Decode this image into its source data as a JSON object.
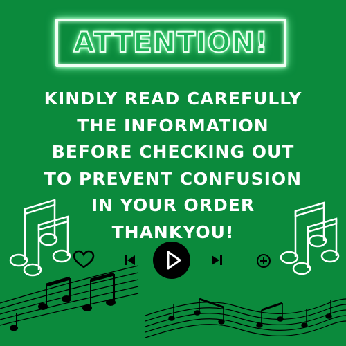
{
  "banner": {
    "title": "ATTENTION!"
  },
  "message": {
    "lines": [
      "KINDLY READ CAREFULLY",
      "THE INFORMATION",
      "BEFORE CHECKING OUT",
      "TO PREVENT CONFUSION",
      "IN YOUR ORDER",
      "THANKYOU!"
    ]
  },
  "player": {
    "icons": [
      "heart-icon",
      "previous-icon",
      "play-icon",
      "next-icon",
      "add-icon"
    ]
  },
  "decor": {
    "icons": [
      "music-notes-left-icon",
      "music-notes-right-icon",
      "music-staff-left-icon",
      "music-staff-right-icon"
    ]
  },
  "colors": {
    "background": "#0b8a3c",
    "text": "#ffffff",
    "icon": "#000000"
  }
}
